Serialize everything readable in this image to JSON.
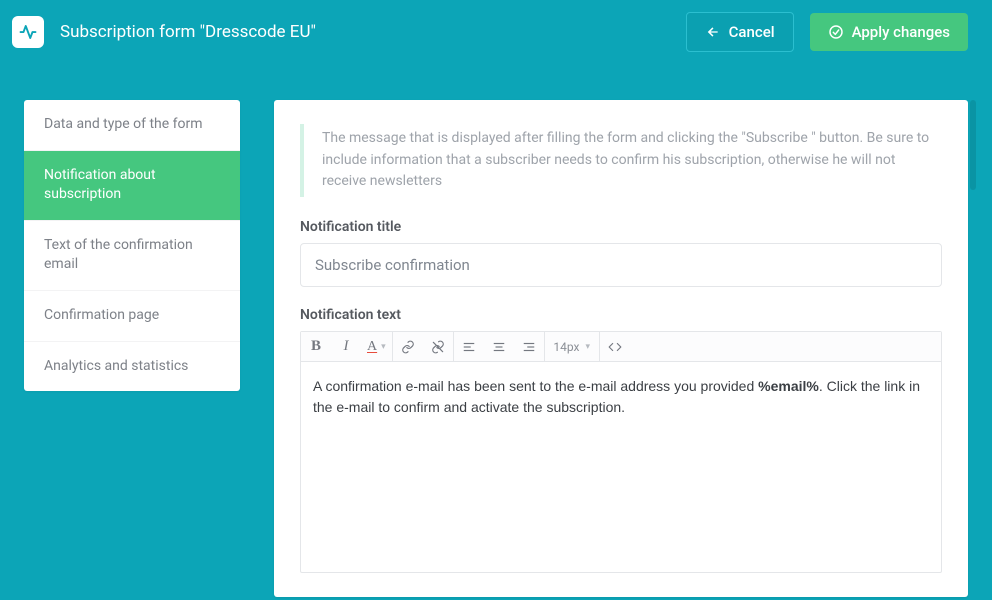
{
  "header": {
    "title": "Subscription form \"Dresscode EU\"",
    "cancel": "Cancel",
    "apply": "Apply changes"
  },
  "sidebar": {
    "items": [
      {
        "label": "Data and type of the form"
      },
      {
        "label": "Notification about subscription"
      },
      {
        "label": "Text of the confirmation email"
      },
      {
        "label": "Confirmation page"
      },
      {
        "label": "Analytics and statistics"
      }
    ]
  },
  "panel": {
    "help": "The message that is displayed after filling the form and clicking the \"Subscribe \" button. Be sure to include information that a subscriber needs to confirm his subscription, otherwise he will not receive newsletters",
    "title_label": "Notification title",
    "title_value": "Subscribe confirmation",
    "text_label": "Notification text",
    "font_size": "14px",
    "body_prefix": "A confirmation e-mail has been sent to the e-mail address you provided ",
    "body_token": "%email%",
    "body_suffix": ". Click the link in the e-mail to confirm and activate the subscription."
  }
}
